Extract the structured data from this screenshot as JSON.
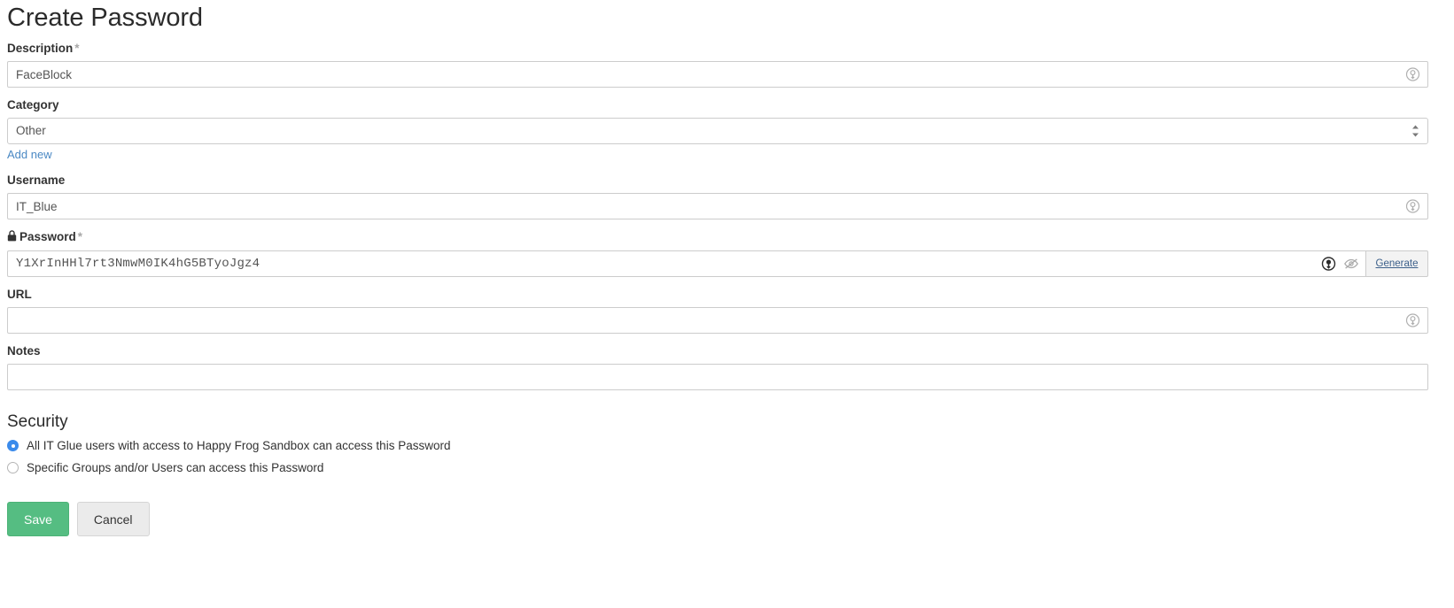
{
  "page": {
    "title": "Create Password"
  },
  "fields": {
    "description": {
      "label": "Description",
      "required_marker": "*",
      "value": "FaceBlock",
      "placeholder": "",
      "icon": "copy-circle-icon"
    },
    "category": {
      "label": "Category",
      "value": "Other",
      "add_new_label": "Add new",
      "icon": "select-spinner-icon"
    },
    "username": {
      "label": "Username",
      "value": "IT_Blue",
      "placeholder": "",
      "icon": "copy-circle-icon"
    },
    "password": {
      "label": "Password",
      "required_marker": "*",
      "lock_icon": "lock-icon",
      "value": "Y1XrInHHl7rt3NmwM0IK4hG5BTyoJgz4",
      "placeholder": "",
      "copy_icon": "copy-circle-icon",
      "reveal_icon": "eye-slash-icon",
      "generate_label": "Generate"
    },
    "url": {
      "label": "URL",
      "value": "",
      "placeholder": "",
      "icon": "copy-circle-icon"
    },
    "notes": {
      "label": "Notes",
      "value": "",
      "placeholder": ""
    }
  },
  "security": {
    "heading": "Security",
    "options": [
      {
        "label": "All IT Glue users with access to Happy Frog Sandbox can access this Password",
        "selected": true
      },
      {
        "label": "Specific Groups and/or Users can access this Password",
        "selected": false
      }
    ]
  },
  "actions": {
    "save_label": "Save",
    "cancel_label": "Cancel"
  },
  "colors": {
    "save_green": "#55bd82",
    "link_blue": "#4b89c4",
    "radio_blue": "#3b8beb",
    "border_grey": "#cccccc"
  }
}
